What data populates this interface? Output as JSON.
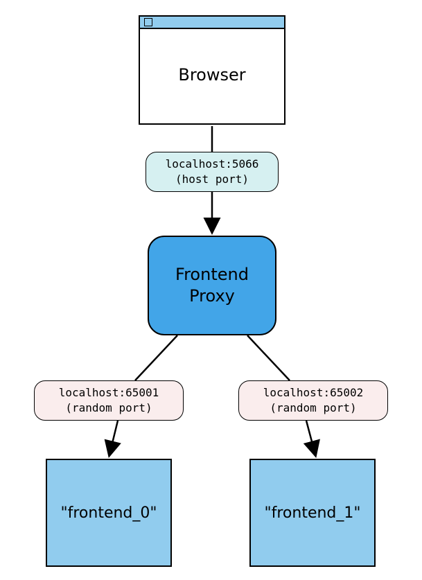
{
  "nodes": {
    "browser": {
      "label": "Browser"
    },
    "proxy": {
      "line1": "Frontend",
      "line2": "Proxy"
    },
    "instance_left": {
      "label": "\"frontend_0\""
    },
    "instance_right": {
      "label": "\"frontend_1\""
    }
  },
  "edges": {
    "host": {
      "line1": "localhost:5066",
      "line2": "(host port)"
    },
    "left": {
      "line1": "localhost:65001",
      "line2": "(random port)"
    },
    "right": {
      "line1": "localhost:65002",
      "line2": "(random port)"
    }
  }
}
